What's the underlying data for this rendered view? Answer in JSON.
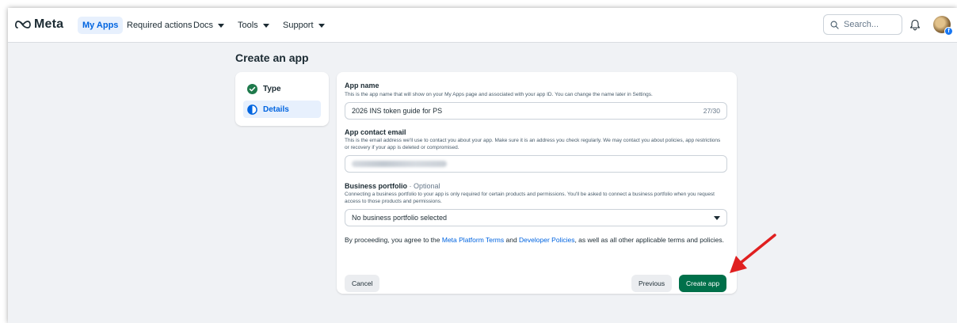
{
  "brand": {
    "name": "Meta",
    "color": "#0081fb"
  },
  "nav": {
    "items": [
      {
        "label": "My Apps",
        "active": true,
        "dropdown": false
      },
      {
        "label": "Required actions",
        "active": false,
        "dropdown": false
      },
      {
        "label": "Docs",
        "active": false,
        "dropdown": true
      },
      {
        "label": "Tools",
        "active": false,
        "dropdown": true
      },
      {
        "label": "Support",
        "active": false,
        "dropdown": true
      }
    ],
    "search_placeholder": "Search..."
  },
  "page": {
    "title": "Create an app",
    "steps": [
      {
        "label": "Type",
        "state": "complete"
      },
      {
        "label": "Details",
        "state": "current"
      }
    ]
  },
  "form": {
    "app_name": {
      "label": "App name",
      "help": "This is the app name that will show on your My Apps page and associated with your app ID. You can change the name later in Settings.",
      "value": "2026 INS token guide for PS",
      "counter": "27/30"
    },
    "contact_email": {
      "label": "App contact email",
      "help": "This is the email address we'll use to contact you about your app. Make sure it is an address you check regularly. We may contact you about policies, app restrictions or recovery if your app is deleted or compromised."
    },
    "business_portfolio": {
      "label": "Business portfolio",
      "optional": " · Optional",
      "help": "Connecting a business portfolio to your app is only required for certain products and permissions. You'll be asked to connect a business portfolio when you request access to those products and permissions.",
      "selected": "No business portfolio selected"
    },
    "terms": {
      "prefix": "By proceeding, you agree to the ",
      "link1": "Meta Platform Terms",
      "middle": " and ",
      "link2": "Developer Policies",
      "suffix": ", as well as all other applicable terms and policies."
    },
    "buttons": {
      "cancel": "Cancel",
      "previous": "Previous",
      "create": "Create app"
    }
  },
  "colors": {
    "accent": "#0064e0",
    "primary_button": "#00704a",
    "step_complete": "#1f7a4c",
    "annotation_arrow": "#e02020"
  }
}
